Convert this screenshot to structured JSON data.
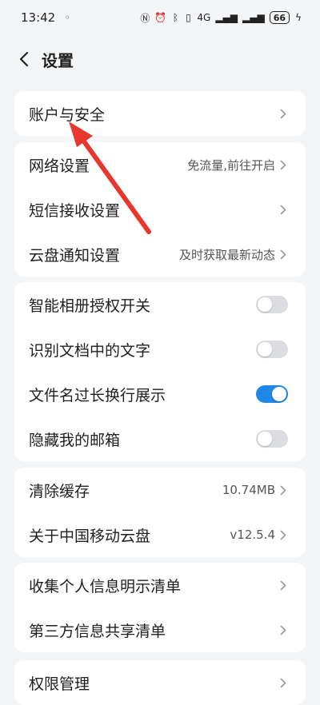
{
  "status_bar": {
    "time": "13:42",
    "battery": "66",
    "network": "4G"
  },
  "header": {
    "title": "设置",
    "back_icon": "chevron-left-icon"
  },
  "groups": [
    {
      "items": [
        {
          "label": "账户与安全",
          "value": "",
          "type": "link"
        }
      ]
    },
    {
      "items": [
        {
          "label": "网络设置",
          "value": "免流量,前往开启",
          "type": "link"
        },
        {
          "label": "短信接收设置",
          "value": "",
          "type": "link"
        },
        {
          "label": "云盘通知设置",
          "value": "及时获取最新动态",
          "type": "link"
        }
      ]
    },
    {
      "items": [
        {
          "label": "智能相册授权开关",
          "type": "toggle",
          "on": false
        },
        {
          "label": "识别文档中的文字",
          "type": "toggle",
          "on": false
        },
        {
          "label": "文件名过长换行展示",
          "type": "toggle",
          "on": true
        },
        {
          "label": "隐藏我的邮箱",
          "type": "toggle",
          "on": false
        }
      ]
    },
    {
      "items": [
        {
          "label": "清除缓存",
          "value": "10.74MB",
          "type": "link"
        },
        {
          "label": "关于中国移动云盘",
          "value": "v12.5.4",
          "type": "link"
        }
      ]
    },
    {
      "items": [
        {
          "label": "收集个人信息明示清单",
          "value": "",
          "type": "link"
        },
        {
          "label": "第三方信息共享清单",
          "value": "",
          "type": "link"
        }
      ]
    },
    {
      "items": [
        {
          "label": "权限管理",
          "value": "",
          "type": "link"
        }
      ]
    }
  ],
  "colors": {
    "accent": "#1e88e5",
    "annotation_arrow": "#e8372f",
    "background": "#f4f5f7"
  }
}
